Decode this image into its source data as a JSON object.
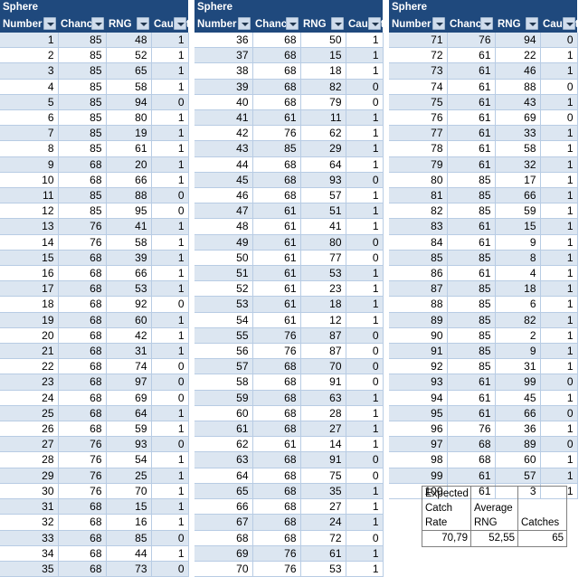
{
  "columns": {
    "sphere_number": {
      "line1": "Sphere",
      "line2": "Number"
    },
    "chance": "Chance",
    "rng": "RNG",
    "caught": "Caught",
    "filter_icon": "filter-dropdown-icon"
  },
  "colors": {
    "header_background": "#1F497D",
    "header_text": "#FFFFFF",
    "band_row": "#DCE6F1",
    "plain_row": "#FFFFFF",
    "grid_line": "#B8CCE4",
    "summary_border": "#808080"
  },
  "groups": [
    {
      "id": "group-1",
      "first_row_banded": true,
      "rows": [
        [
          1,
          85,
          48,
          1
        ],
        [
          2,
          85,
          52,
          1
        ],
        [
          3,
          85,
          65,
          1
        ],
        [
          4,
          85,
          58,
          1
        ],
        [
          5,
          85,
          94,
          0
        ],
        [
          6,
          85,
          80,
          1
        ],
        [
          7,
          85,
          19,
          1
        ],
        [
          8,
          85,
          61,
          1
        ],
        [
          9,
          68,
          20,
          1
        ],
        [
          10,
          68,
          66,
          1
        ],
        [
          11,
          85,
          88,
          0
        ],
        [
          12,
          85,
          95,
          0
        ],
        [
          13,
          76,
          41,
          1
        ],
        [
          14,
          76,
          58,
          1
        ],
        [
          15,
          68,
          39,
          1
        ],
        [
          16,
          68,
          66,
          1
        ],
        [
          17,
          68,
          53,
          1
        ],
        [
          18,
          68,
          92,
          0
        ],
        [
          19,
          68,
          60,
          1
        ],
        [
          20,
          68,
          42,
          1
        ],
        [
          21,
          68,
          31,
          1
        ],
        [
          22,
          68,
          74,
          0
        ],
        [
          23,
          68,
          97,
          0
        ],
        [
          24,
          68,
          69,
          0
        ],
        [
          25,
          68,
          64,
          1
        ],
        [
          26,
          68,
          59,
          1
        ],
        [
          27,
          76,
          93,
          0
        ],
        [
          28,
          76,
          54,
          1
        ],
        [
          29,
          76,
          25,
          1
        ],
        [
          30,
          76,
          70,
          1
        ],
        [
          31,
          68,
          15,
          1
        ],
        [
          32,
          68,
          16,
          1
        ],
        [
          33,
          68,
          85,
          0
        ],
        [
          34,
          68,
          44,
          1
        ],
        [
          35,
          68,
          73,
          0
        ]
      ]
    },
    {
      "id": "group-2",
      "first_row_banded": false,
      "rows": [
        [
          36,
          68,
          50,
          1
        ],
        [
          37,
          68,
          15,
          1
        ],
        [
          38,
          68,
          18,
          1
        ],
        [
          39,
          68,
          82,
          0
        ],
        [
          40,
          68,
          79,
          0
        ],
        [
          41,
          61,
          11,
          1
        ],
        [
          42,
          76,
          62,
          1
        ],
        [
          43,
          85,
          29,
          1
        ],
        [
          44,
          68,
          64,
          1
        ],
        [
          45,
          68,
          93,
          0
        ],
        [
          46,
          68,
          57,
          1
        ],
        [
          47,
          61,
          51,
          1
        ],
        [
          48,
          61,
          41,
          1
        ],
        [
          49,
          61,
          80,
          0
        ],
        [
          50,
          61,
          77,
          0
        ],
        [
          51,
          61,
          53,
          1
        ],
        [
          52,
          61,
          23,
          1
        ],
        [
          53,
          61,
          18,
          1
        ],
        [
          54,
          61,
          12,
          1
        ],
        [
          55,
          76,
          87,
          0
        ],
        [
          56,
          76,
          87,
          0
        ],
        [
          57,
          68,
          70,
          0
        ],
        [
          58,
          68,
          91,
          0
        ],
        [
          59,
          68,
          63,
          1
        ],
        [
          60,
          68,
          28,
          1
        ],
        [
          61,
          68,
          27,
          1
        ],
        [
          62,
          61,
          14,
          1
        ],
        [
          63,
          68,
          91,
          0
        ],
        [
          64,
          68,
          75,
          0
        ],
        [
          65,
          68,
          35,
          1
        ],
        [
          66,
          68,
          27,
          1
        ],
        [
          67,
          68,
          24,
          1
        ],
        [
          68,
          68,
          72,
          0
        ],
        [
          69,
          76,
          61,
          1
        ],
        [
          70,
          76,
          53,
          1
        ]
      ]
    },
    {
      "id": "group-3",
      "first_row_banded": true,
      "rows": [
        [
          71,
          76,
          94,
          0
        ],
        [
          72,
          61,
          22,
          1
        ],
        [
          73,
          61,
          46,
          1
        ],
        [
          74,
          61,
          88,
          0
        ],
        [
          75,
          61,
          43,
          1
        ],
        [
          76,
          61,
          69,
          0
        ],
        [
          77,
          61,
          33,
          1
        ],
        [
          78,
          61,
          58,
          1
        ],
        [
          79,
          61,
          32,
          1
        ],
        [
          80,
          85,
          17,
          1
        ],
        [
          81,
          85,
          66,
          1
        ],
        [
          82,
          85,
          59,
          1
        ],
        [
          83,
          61,
          15,
          1
        ],
        [
          84,
          61,
          9,
          1
        ],
        [
          85,
          85,
          8,
          1
        ],
        [
          86,
          61,
          4,
          1
        ],
        [
          87,
          85,
          18,
          1
        ],
        [
          88,
          85,
          6,
          1
        ],
        [
          89,
          85,
          82,
          1
        ],
        [
          90,
          85,
          2,
          1
        ],
        [
          91,
          85,
          9,
          1
        ],
        [
          92,
          85,
          31,
          1
        ],
        [
          93,
          61,
          99,
          0
        ],
        [
          94,
          61,
          45,
          1
        ],
        [
          95,
          61,
          66,
          0
        ],
        [
          96,
          76,
          36,
          1
        ],
        [
          97,
          68,
          89,
          0
        ],
        [
          98,
          68,
          60,
          1
        ],
        [
          99,
          61,
          57,
          1
        ],
        [
          100,
          61,
          3,
          1
        ]
      ]
    }
  ],
  "summary": {
    "labels": [
      "Expected Catch Rate",
      "Average RNG",
      "Catches"
    ],
    "values": [
      "70,79",
      "52,55",
      "65"
    ]
  }
}
